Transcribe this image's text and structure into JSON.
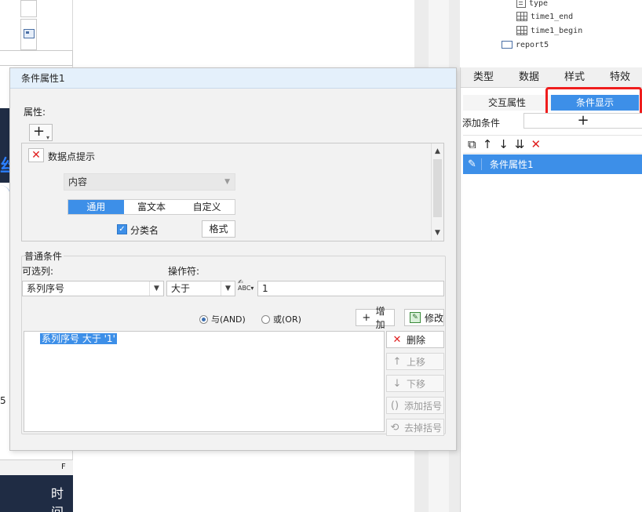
{
  "tree": {
    "fields": [
      "type",
      "time1_end",
      "time1_begin"
    ],
    "report": "report5"
  },
  "sheet": {
    "blue_glyph": "丝",
    "row_num": "5",
    "col_header": "F",
    "bottom_text": "时间"
  },
  "right_panel": {
    "tabs": [
      "类型",
      "数据",
      "样式",
      "特效"
    ],
    "subtabs": [
      "交互属性",
      "条件显示"
    ],
    "add_condition_label": "添加条件",
    "add_icon": "+",
    "toolbar_icons": [
      "copy-icon",
      "arrow-up-icon",
      "arrow-down-icon",
      "move-bottom-icon",
      "delete-icon"
    ],
    "condition_item": "条件属性1"
  },
  "dialog": {
    "title": "条件属性1",
    "attr_label": "属性:",
    "property_name": "数据点提示",
    "content_select": "内容",
    "seg_tabs": [
      "通用",
      "富文本",
      "自定义"
    ],
    "checkbox_label": "分类名",
    "format_button": "格式",
    "normal_title": "普通条件",
    "column_label": "可选列:",
    "operator_label": "操作符:",
    "column_value": "系列序号",
    "operator_value": "大于",
    "value": "1",
    "radio_and": "与(AND)",
    "radio_or": "或(OR)",
    "add_button": "增加",
    "modify_button": "修改",
    "delete_button": "删除",
    "up_button": "上移",
    "down_button": "下移",
    "add_bracket_button": "添加括号",
    "remove_bracket_button": "去掉括号",
    "condition_text": "系列序号 大于 '1'"
  }
}
